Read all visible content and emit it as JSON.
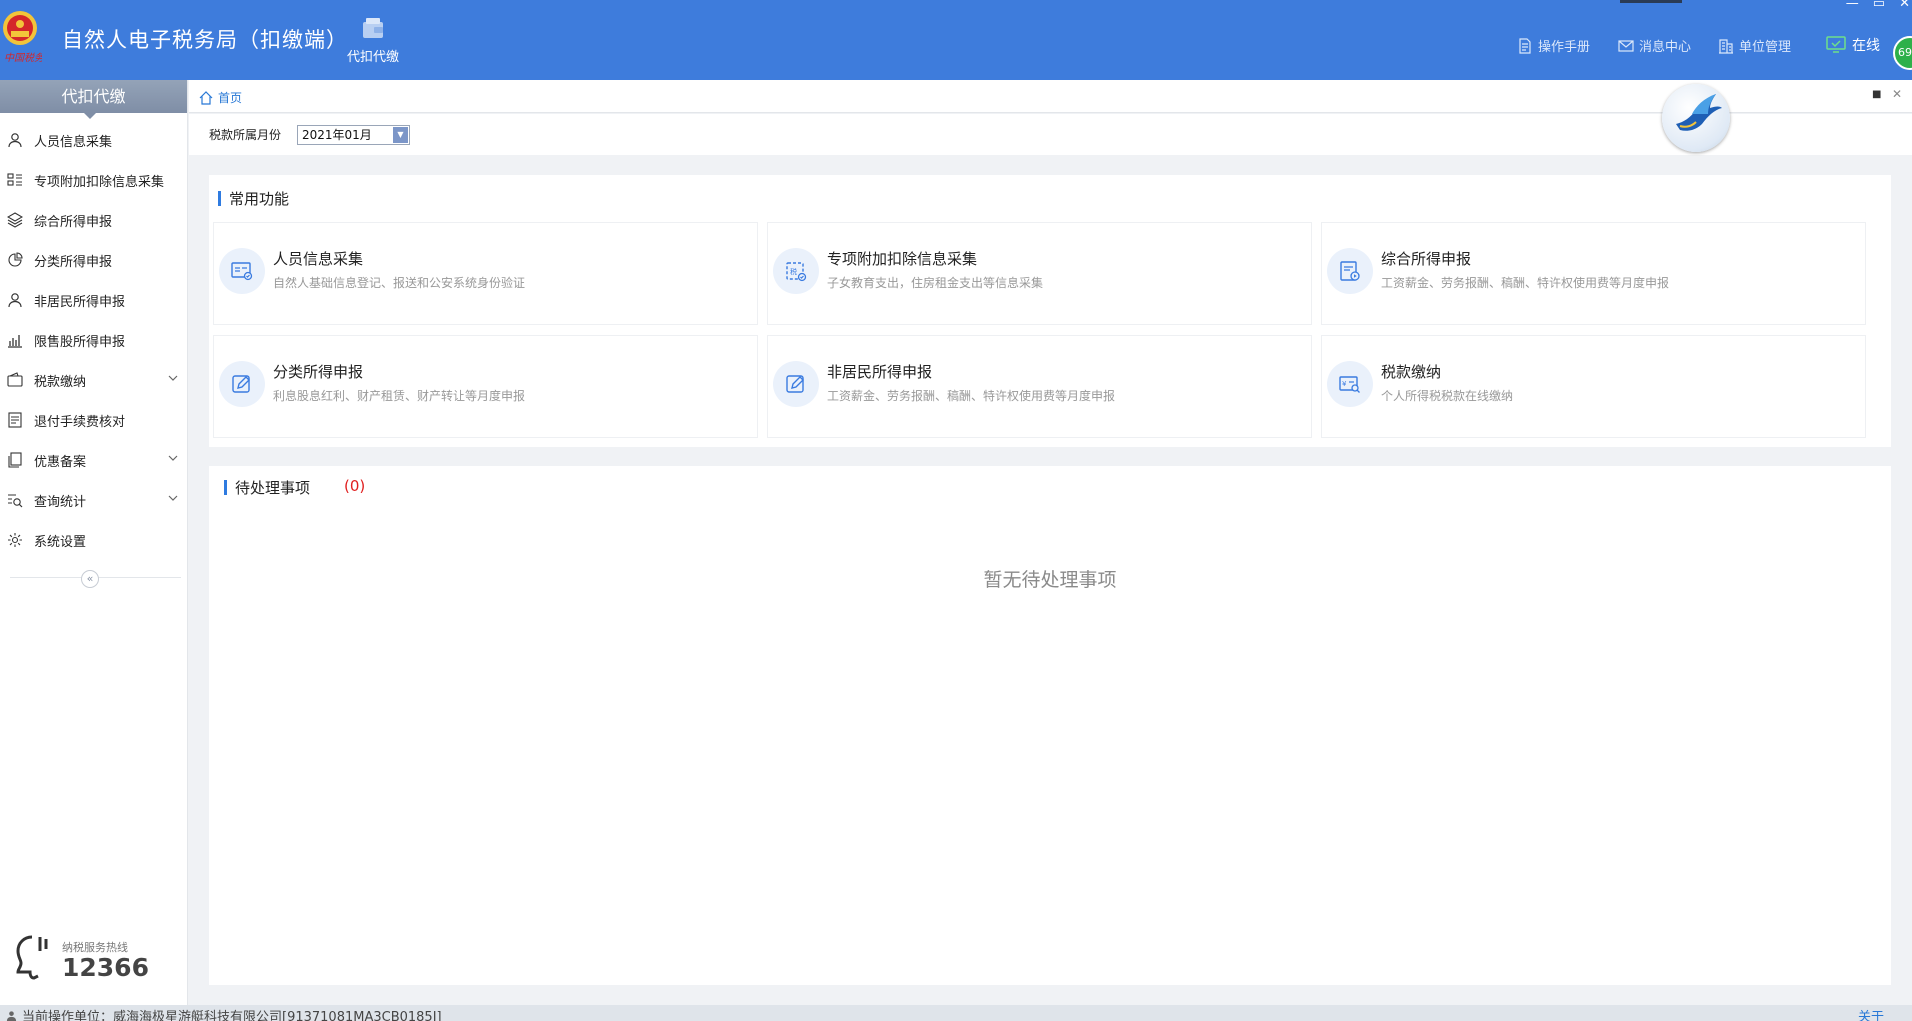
{
  "header": {
    "app_title": "自然人电子税务局（扣缴端）",
    "module_label": "代扣代缴",
    "links": {
      "manual": "操作手册",
      "messages": "消息中心",
      "unit_mgmt": "单位管理"
    },
    "online_label": "在线",
    "online_badge": "69",
    "accent_color": "#3e7cdc"
  },
  "sidebar": {
    "title": "代扣代缴",
    "items": [
      {
        "label": "人员信息采集",
        "icon": "person-icon"
      },
      {
        "label": "专项附加扣除信息采集",
        "icon": "list-icon"
      },
      {
        "label": "综合所得申报",
        "icon": "layers-icon"
      },
      {
        "label": "分类所得申报",
        "icon": "pie-icon"
      },
      {
        "label": "非居民所得申报",
        "icon": "person-icon"
      },
      {
        "label": "限售股所得申报",
        "icon": "bar-chart-icon"
      },
      {
        "label": "税款缴纳",
        "icon": "wallet-icon",
        "expandable": true
      },
      {
        "label": "退付手续费核对",
        "icon": "document-icon"
      },
      {
        "label": "优惠备案",
        "icon": "copy-icon",
        "expandable": true
      },
      {
        "label": "查询统计",
        "icon": "search-list-icon",
        "expandable": true
      },
      {
        "label": "系统设置",
        "icon": "gear-icon"
      }
    ],
    "collapse_glyph": "«",
    "hotline_label": "纳税服务热线",
    "hotline_number": "12366"
  },
  "tabs": {
    "home": "首页"
  },
  "filter": {
    "period_label": "税款所属月份",
    "period_value": "2021年01月"
  },
  "common": {
    "title": "常用功能",
    "cards": [
      {
        "title": "人员信息采集",
        "desc": "自然人基础信息登记、报送和公安系统身份验证"
      },
      {
        "title": "专项附加扣除信息采集",
        "desc": "子女教育支出，住房租金支出等信息采集"
      },
      {
        "title": "综合所得申报",
        "desc": "工资薪金、劳务报酬、稿酬、特许权使用费等月度申报"
      },
      {
        "title": "分类所得申报",
        "desc": "利息股息红利、财产租赁、财产转让等月度申报"
      },
      {
        "title": "非居民所得申报",
        "desc": "工资薪金、劳务报酬、稿酬、特许权使用费等月度申报"
      },
      {
        "title": "税款缴纳",
        "desc": "个人所得税税款在线缴纳"
      }
    ]
  },
  "pending": {
    "title": "待处理事项",
    "count": "(0)",
    "empty_text": "暂无待处理事项"
  },
  "statusbar": {
    "unit": "当前操作单位：威海海极星游艇科技有限公司[91371081MA3CB0185J]",
    "about": "关于"
  }
}
